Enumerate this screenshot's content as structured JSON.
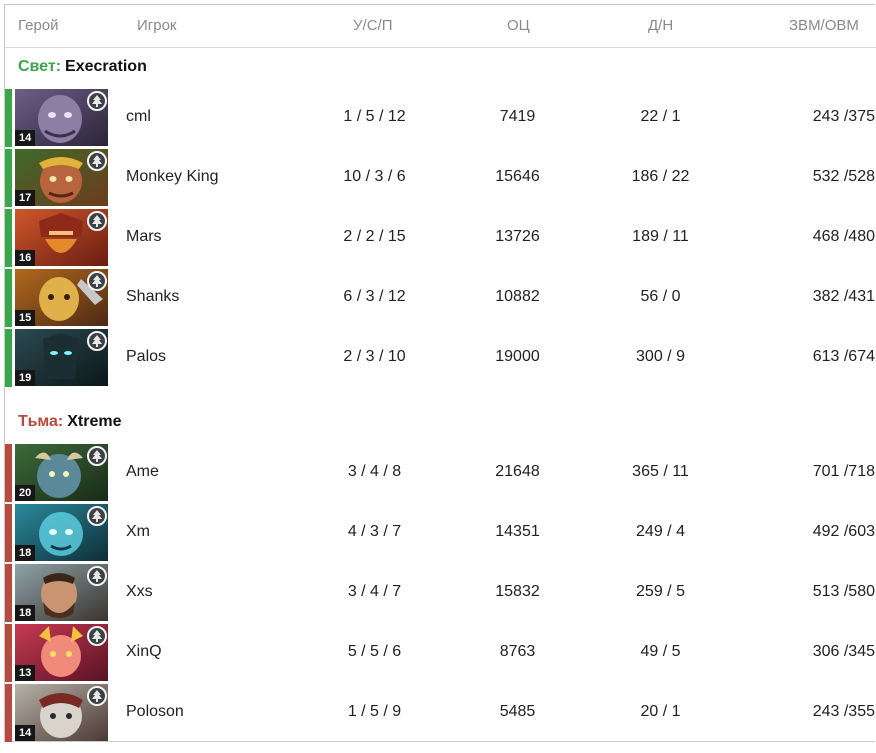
{
  "header": {
    "hero": "Герой",
    "player": "Игрок",
    "kda": "У/С/П",
    "networth": "ОЦ",
    "lasthits": "Д/Н",
    "gpm_xpm": "ЗВМ/ОВМ"
  },
  "teams": [
    {
      "side_label": "Свет:",
      "team_name": "Execration",
      "side_color": "#3aa64b",
      "players": [
        {
          "level": "14",
          "name": "cml",
          "kda": "1 / 5 / 12",
          "networth": "7419",
          "lh_dn": "22 / 1",
          "gpm_xpm": "243 /375"
        },
        {
          "level": "17",
          "name": "Monkey King",
          "kda": "10 / 3 / 6",
          "networth": "15646",
          "lh_dn": "186 / 22",
          "gpm_xpm": "532 /528"
        },
        {
          "level": "16",
          "name": "Mars",
          "kda": "2 / 2 / 15",
          "networth": "13726",
          "lh_dn": "189 / 11",
          "gpm_xpm": "468 /480"
        },
        {
          "level": "15",
          "name": "Shanks",
          "kda": "6 / 3 / 12",
          "networth": "10882",
          "lh_dn": "56 / 0",
          "gpm_xpm": "382 /431"
        },
        {
          "level": "19",
          "name": "Palos",
          "kda": "2 / 3 / 10",
          "networth": "19000",
          "lh_dn": "300 / 9",
          "gpm_xpm": "613 /674"
        }
      ]
    },
    {
      "side_label": "Тьма:",
      "team_name": "Xtreme",
      "side_color": "#b74a3c",
      "players": [
        {
          "level": "20",
          "name": "Ame",
          "kda": "3 / 4 / 8",
          "networth": "21648",
          "lh_dn": "365 / 11",
          "gpm_xpm": "701 /718"
        },
        {
          "level": "18",
          "name": "Xm",
          "kda": "4 / 3 / 7",
          "networth": "14351",
          "lh_dn": "249 / 4",
          "gpm_xpm": "492 /603"
        },
        {
          "level": "18",
          "name": "Xxs",
          "kda": "3 / 4 / 7",
          "networth": "15832",
          "lh_dn": "259 / 5",
          "gpm_xpm": "513 /580"
        },
        {
          "level": "13",
          "name": "XinQ",
          "kda": "5 / 5 / 6",
          "networth": "8763",
          "lh_dn": "49 / 5",
          "gpm_xpm": "306 /345"
        },
        {
          "level": "14",
          "name": "Poloson",
          "kda": "1 / 5 / 9",
          "networth": "5485",
          "lh_dn": "20 / 1",
          "gpm_xpm": "243 /355"
        }
      ]
    }
  ]
}
